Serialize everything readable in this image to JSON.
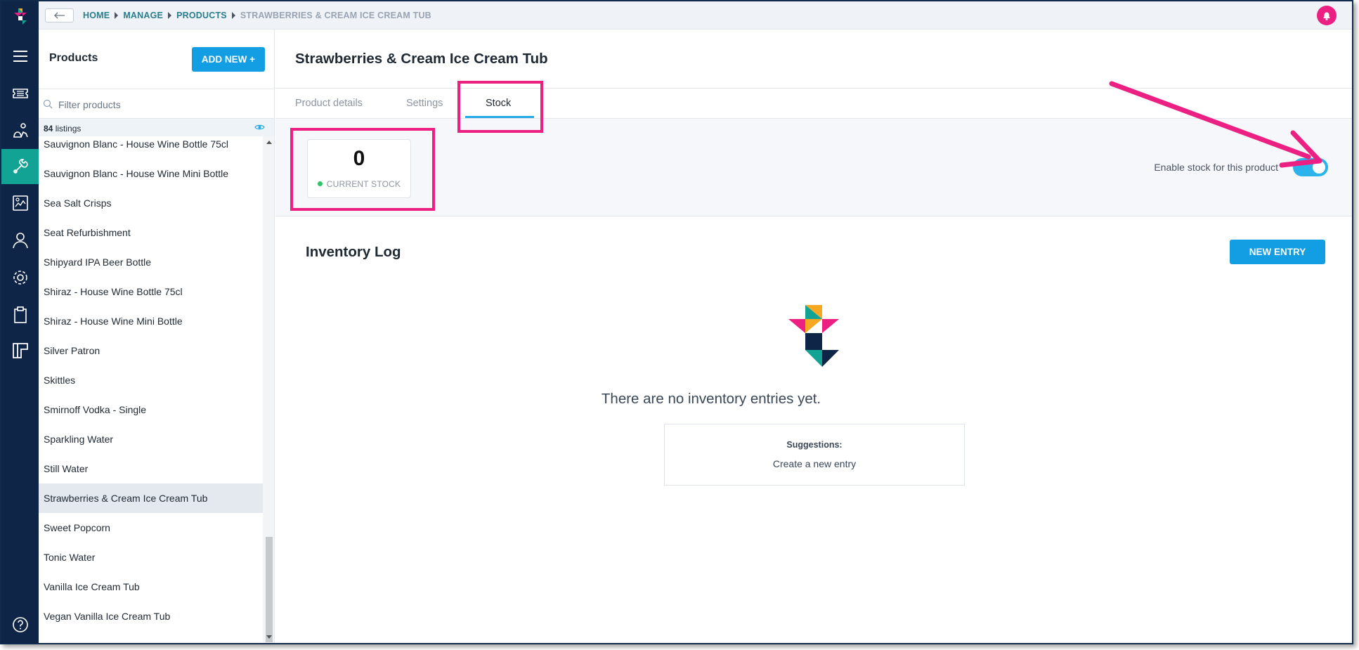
{
  "topbar": {
    "breadcrumb": [
      "HOME",
      "MANAGE",
      "PRODUCTS",
      "STRAWBERRIES & CREAM ICE CREAM TUB"
    ]
  },
  "sidebar": {
    "title": "Products",
    "add_new_label": "ADD NEW +",
    "filter_placeholder": "Filter products",
    "listings_count": "84",
    "listings_label": "listings",
    "products": [
      "Sauvignon Blanc - House Wine Bottle 75cl",
      "Sauvignon Blanc - House Wine Mini Bottle",
      "Sea Salt Crisps",
      "Seat Refurbishment",
      "Shipyard IPA Beer Bottle",
      "Shiraz - House Wine Bottle 75cl",
      "Shiraz - House Wine Mini Bottle",
      "Silver Patron",
      "Skittles",
      "Smirnoff Vodka - Single",
      "Sparkling Water",
      "Still Water",
      "Strawberries & Cream Ice Cream Tub",
      "Sweet Popcorn",
      "Tonic Water",
      "Vanilla Ice Cream Tub",
      "Vegan Vanilla Ice Cream Tub"
    ],
    "selected_index": 12
  },
  "main": {
    "title": "Strawberries & Cream Ice Cream Tub",
    "tabs": [
      "Product details",
      "Settings",
      "Stock"
    ],
    "active_tab": 2,
    "stock": {
      "value": "0",
      "label": "CURRENT STOCK",
      "enable_label": "Enable stock for this product",
      "enabled": true
    },
    "inventory": {
      "title": "Inventory Log",
      "new_entry_label": "NEW ENTRY",
      "empty_message": "There are no inventory entries yet.",
      "suggestions_title": "Suggestions:",
      "suggestion": "Create a new entry"
    }
  },
  "colors": {
    "rail": "#0f2547",
    "rail_active": "#13a394",
    "primary_button": "#139de3",
    "annotation": "#ec1f83",
    "toggle_on": "#2bb3ec"
  },
  "icons": {
    "rail": [
      "logo-icon",
      "menu-icon",
      "ticket-icon",
      "chart-icon",
      "tools-icon",
      "report-icon",
      "user-icon",
      "gear-icon",
      "clipboard-icon",
      "layout-icon",
      "help-icon"
    ]
  }
}
